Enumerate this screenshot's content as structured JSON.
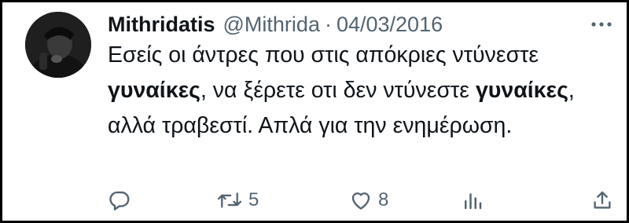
{
  "tweet": {
    "author_name": "Mithridatis",
    "author_handle": "@Mithrida",
    "separator": "·",
    "date": "04/03/2016",
    "text_parts": {
      "p1": "Εσείς οι άντρες που στις απόκριες ντύνεστε ",
      "p2": "γυναίκες",
      "p3": ", να ξέρετε οτι δεν ντύνεστε ",
      "p4": "γυναίκες",
      "p5": ", αλλά τραβεστί. Απλά για την ενημέρωση."
    }
  },
  "actions": {
    "reply_count": "",
    "retweet_count": "5",
    "like_count": "8",
    "views_count": ""
  },
  "icons": {
    "reply": "reply-icon",
    "retweet": "retweet-icon",
    "like": "heart-icon",
    "views": "views-icon",
    "share": "share-icon",
    "more": "more-icon"
  },
  "colors": {
    "text": "#0f1419",
    "secondary": "#536471",
    "background": "#ffffff",
    "frame": "#000000"
  }
}
